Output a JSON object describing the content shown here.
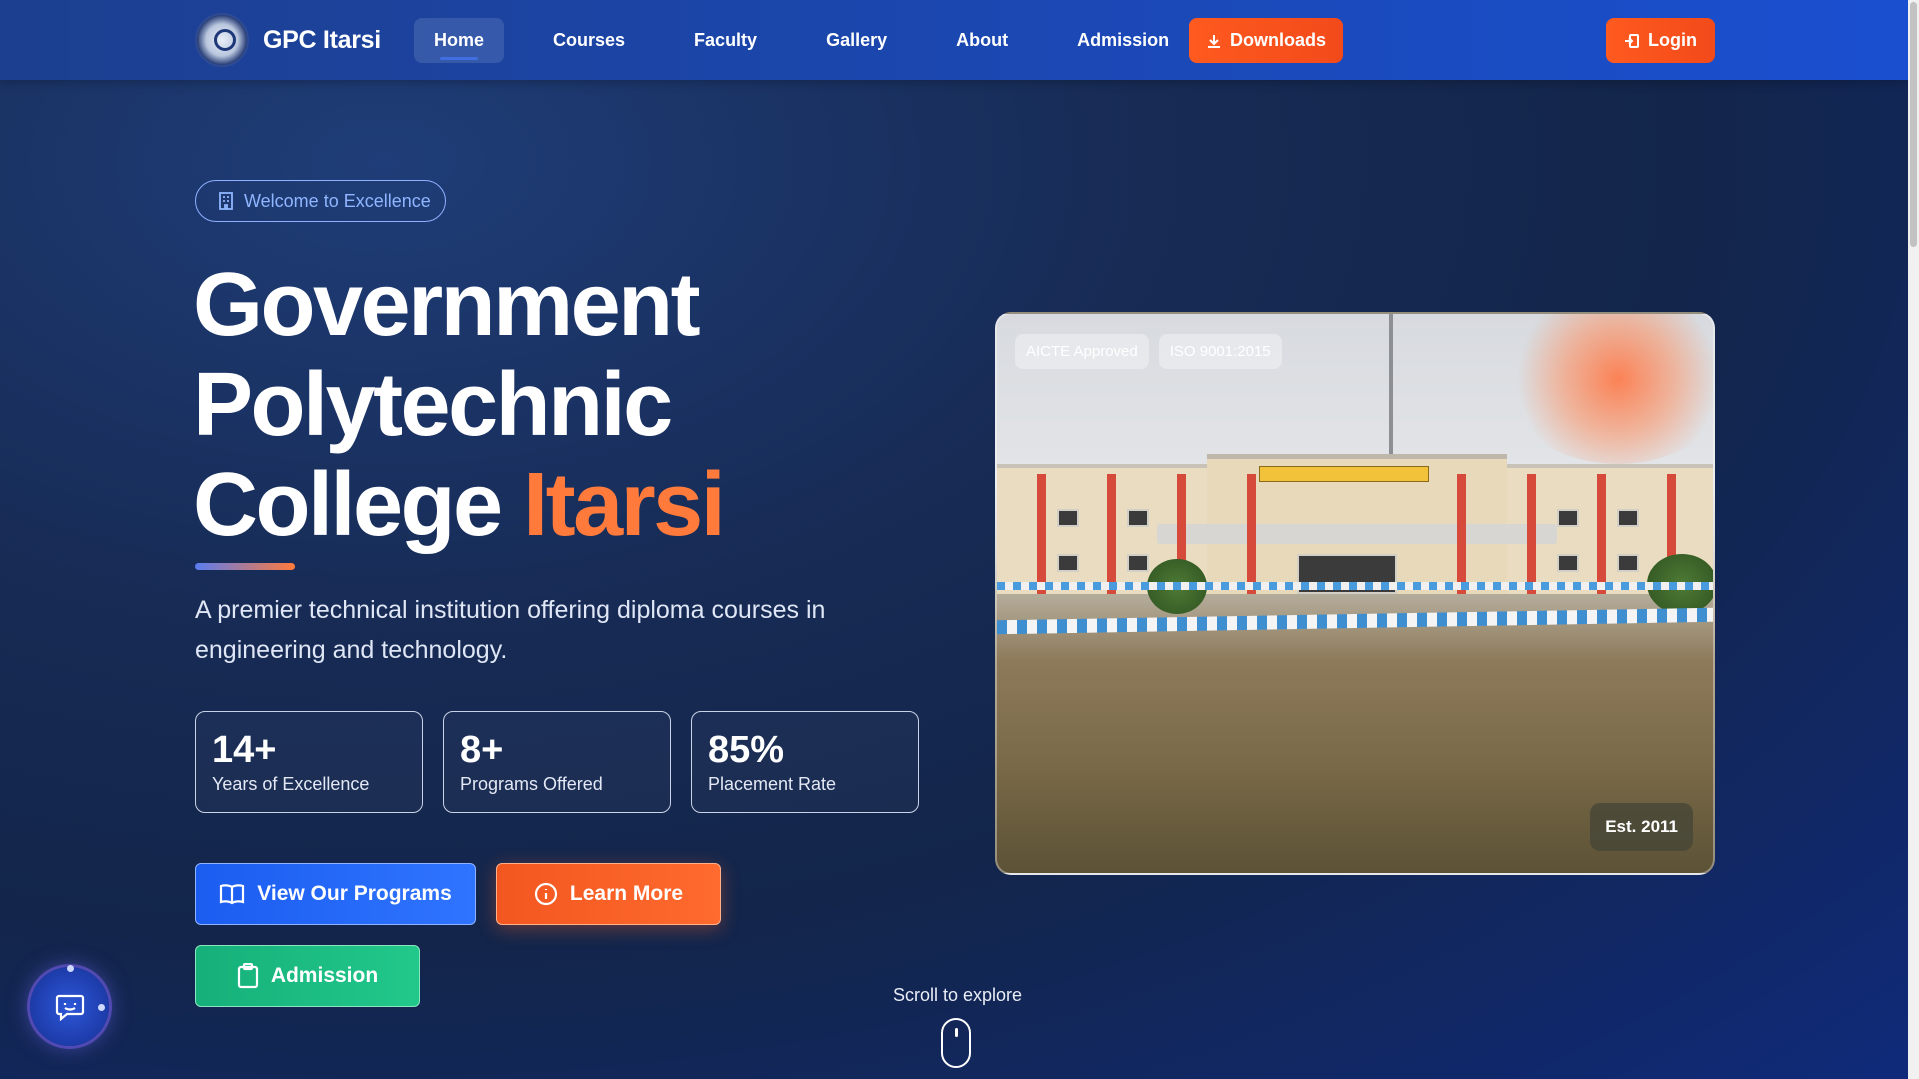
{
  "nav": {
    "brand_name": "GPC Itarsi",
    "links": [
      {
        "label": "Home",
        "active": true
      },
      {
        "label": "Courses"
      },
      {
        "label": "Faculty"
      },
      {
        "label": "Gallery"
      },
      {
        "label": "About"
      },
      {
        "label": "Admission"
      }
    ],
    "downloads_label": "Downloads",
    "login_label": "Login"
  },
  "hero": {
    "welcome_badge": "Welcome to Excellence",
    "title_line1": "Government",
    "title_line2": "Polytechnic",
    "title_line3_main": "College",
    "title_line3_accent": "Itarsi",
    "subtitle": "A premier technical institution offering diploma courses in engineering and technology.",
    "stats": [
      {
        "value": "14+",
        "label": "Years of Excellence"
      },
      {
        "value": "8+",
        "label": "Programs Offered"
      },
      {
        "value": "85%",
        "label": "Placement Rate"
      }
    ],
    "buttons": {
      "programs": "View Our Programs",
      "learn_more": "Learn More",
      "admission": "Admission"
    }
  },
  "image_card": {
    "badges": [
      "AICTE Approved",
      "ISO 9001:2015"
    ],
    "est_badge": "Est. 2011"
  },
  "scroll_hint": "Scroll to explore",
  "icons": {
    "downloads": "download-icon",
    "login": "login-icon",
    "welcome": "building-icon",
    "programs": "book-icon",
    "learn_more": "info-icon",
    "admission": "clipboard-icon",
    "chat": "chat-icon"
  },
  "colors": {
    "accent_orange": "#ff7a3b",
    "primary_blue": "#1b5df0",
    "success_green": "#16b07a",
    "nav_bg": "#1b47b0"
  }
}
